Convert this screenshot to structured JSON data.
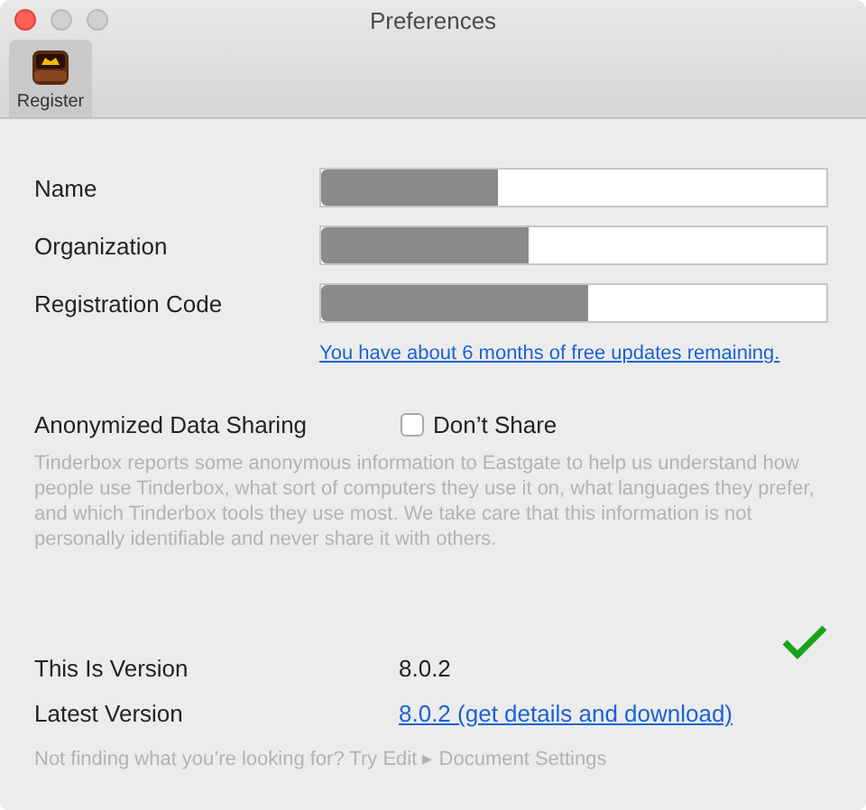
{
  "window": {
    "title": "Preferences"
  },
  "toolbar": {
    "items": [
      {
        "label": "Register",
        "selected": true
      }
    ]
  },
  "registration": {
    "fields": [
      {
        "label": "Name",
        "redacted": true
      },
      {
        "label": "Organization",
        "redacted": true
      },
      {
        "label": "Registration Code",
        "redacted": true
      }
    ],
    "updates_link": "You have about 6 months of free updates remaining."
  },
  "data_sharing": {
    "label": "Anonymized Data Sharing",
    "checkbox": {
      "label": "Don’t Share",
      "checked": false
    },
    "description": "Tinderbox reports some anonymous information to Eastgate to help us understand how people use Tinderbox, what sort of computers they use it on, what languages they prefer, and which Tinderbox tools they use most. We take care that this information is not personally identifiable and never share it with others."
  },
  "version": {
    "current_label": "This Is Version",
    "current": "8.0.2",
    "up_to_date": true,
    "latest_label": "Latest Version",
    "latest_link": "8.0.2 (get details and download)"
  },
  "footer": "Not finding what you’re looking for? Try Edit ▸ Document Settings"
}
